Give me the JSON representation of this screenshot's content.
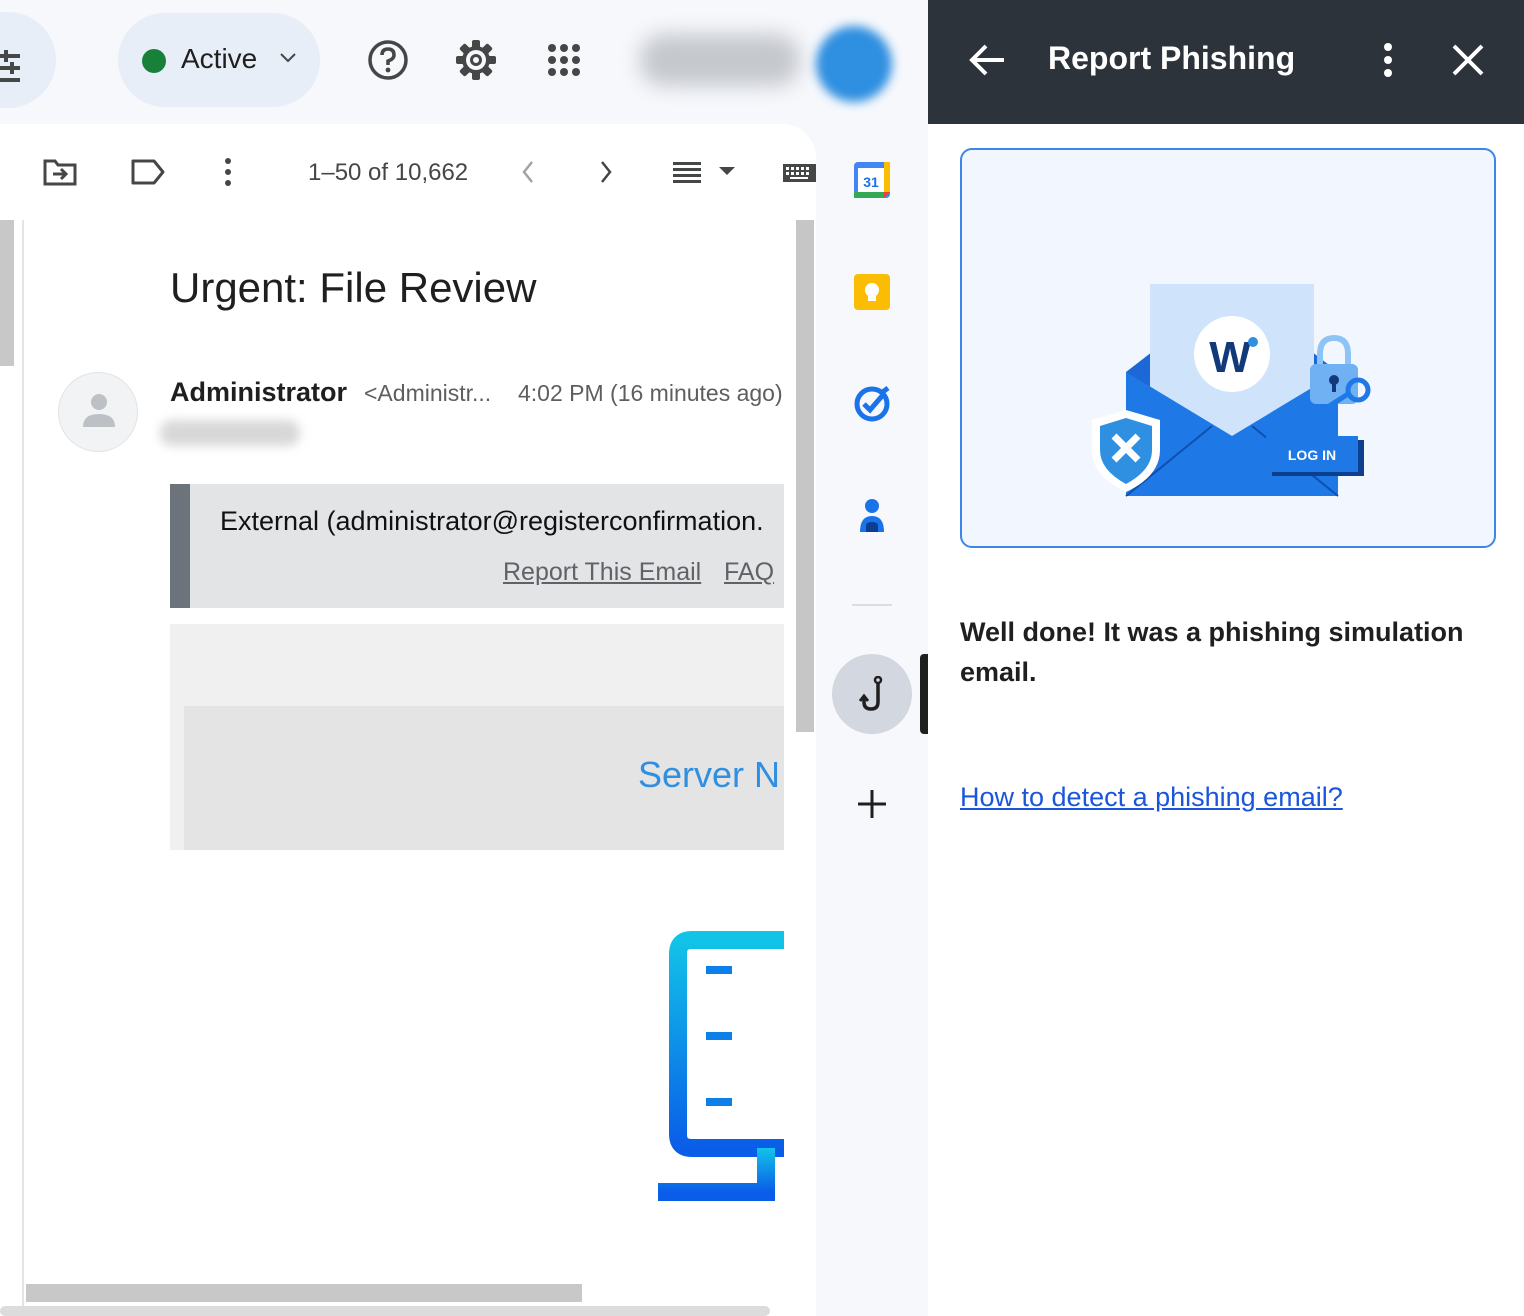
{
  "topbar": {
    "status_label": "Active",
    "icons": [
      "filter-icon",
      "chevron-down-icon",
      "help-icon",
      "gear-icon",
      "apps-grid-icon"
    ]
  },
  "toolbar": {
    "pager_text": "1–50 of 10,662",
    "icons": [
      "move-to-icon",
      "label-icon",
      "more-vert-icon",
      "chevron-left-icon",
      "chevron-right-icon",
      "density-icon",
      "keyboard-icon"
    ]
  },
  "email": {
    "subject": "Urgent: File Review",
    "sender_name": "Administrator",
    "sender_email": "<Administr...",
    "sent_time": "4:02 PM (16 minutes ago)",
    "external_banner": {
      "text": "External (administrator@registerconfirmation.",
      "report_link": "Report This Email",
      "faq_link": "FAQ"
    },
    "body_heading": "Server N"
  },
  "side_apps": [
    "calendar-icon",
    "keep-icon",
    "tasks-icon",
    "contacts-icon",
    "phishing-hook-icon",
    "add-icon"
  ],
  "calendar_day": "31",
  "report_panel": {
    "title": "Report Phishing",
    "illustration_badge": "LOG IN",
    "message": "Well done! It was a phishing simulation email.",
    "help_link": "How to detect a phishing email?"
  },
  "colors": {
    "status_green": "#188038",
    "panel_header": "#2d333b",
    "link_blue": "#1a56db",
    "accent_blue": "#2f8fe0"
  }
}
